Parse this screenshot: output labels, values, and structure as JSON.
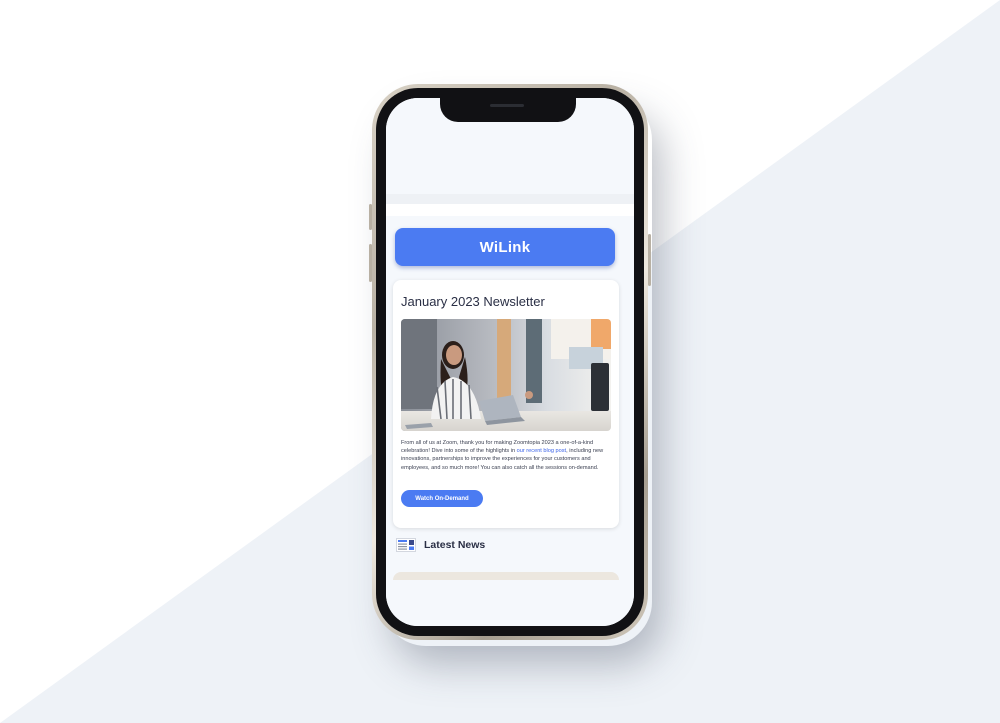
{
  "app": {
    "brand": "WiLink"
  },
  "newsletter": {
    "title": "January 2023 Newsletter",
    "body_part1": "From all of us at Zoom, thank you for making Zoomtopia 2023 a one-of-a-kind celebration! Dive into some of the highlights in ",
    "body_link": "our recent blog post",
    "body_part2": ", including new innovations, partnerships to improve the experiences for your customers and employees, and so much more! You can also catch all the sessions on-demand.",
    "cta_label": "Watch On-Demand"
  },
  "latest_news": {
    "title": "Latest News",
    "icon": "newspaper-icon"
  },
  "colors": {
    "accent": "#4b7bf2",
    "link": "#3b63e8",
    "background_diag": "#eef2f7"
  }
}
